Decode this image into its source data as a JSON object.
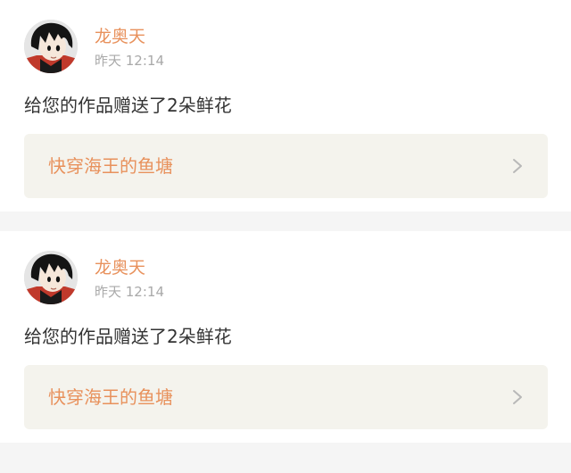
{
  "notifications": [
    {
      "username": "龙奥天",
      "time": "昨天 12:14",
      "message": "给您的作品赠送了2朵鲜花",
      "work_title": "快穿海王的鱼塘"
    },
    {
      "username": "龙奥天",
      "time": "昨天 12:14",
      "message": "给您的作品赠送了2朵鲜花",
      "work_title": "快穿海王的鱼塘"
    }
  ],
  "colors": {
    "accent": "#e8915c",
    "secondary_text": "#a9a9a9",
    "body_text": "#333333",
    "link_card_bg": "#f4f3ed",
    "page_bg": "#f5f5f5"
  },
  "icons": {
    "avatar": "cartoon-avatar-icon",
    "chevron": "chevron-right-icon"
  }
}
